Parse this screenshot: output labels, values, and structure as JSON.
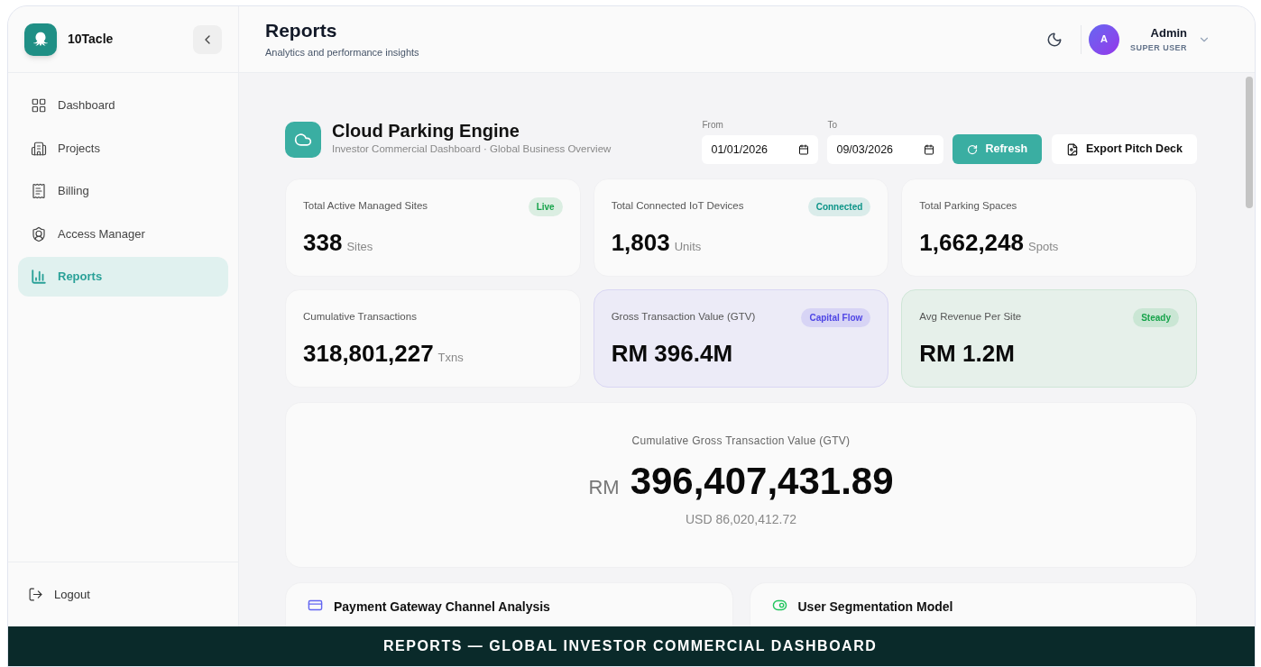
{
  "brand": {
    "name": "10Tacle"
  },
  "sidebar": {
    "items": [
      {
        "label": "Dashboard",
        "selected": false
      },
      {
        "label": "Projects",
        "selected": false
      },
      {
        "label": "Billing",
        "selected": false
      },
      {
        "label": "Access Manager",
        "selected": false
      },
      {
        "label": "Reports",
        "selected": true
      }
    ],
    "logout": "Logout"
  },
  "header": {
    "title": "Reports",
    "subtitle": "Analytics and performance insights",
    "user": {
      "initial": "A",
      "name": "Admin",
      "role": "SUPER USER"
    }
  },
  "engine": {
    "title": "Cloud Parking Engine",
    "subtitle": "Investor Commercial Dashboard · Global Business Overview",
    "from": {
      "label": "From",
      "value": "01/01/2026"
    },
    "to": {
      "label": "To",
      "value": "09/03/2026"
    },
    "refresh": "Refresh",
    "export": "Export Pitch Deck"
  },
  "stats": [
    {
      "kind": "plain",
      "label": "Total Active Managed Sites",
      "value": "338",
      "unit": "Sites",
      "badge": "Live",
      "color": "#16a34a"
    },
    {
      "kind": "plain",
      "label": "Total Connected IoT Devices",
      "value": "1,803",
      "unit": "Units",
      "badge": "Connected",
      "color": "#0d9488"
    },
    {
      "kind": "plain",
      "label": "Total Parking Spaces",
      "value": "1,662,248",
      "unit": "Spots"
    },
    {
      "kind": "plain",
      "label": "Cumulative Transactions",
      "value": "318,801,227",
      "unit": "Txns"
    },
    {
      "kind": "violet",
      "label": "Gross Transaction Value (GTV)",
      "value": "RM 396.4M",
      "badge": "Capital Flow",
      "color": "#4f46e5"
    },
    {
      "kind": "mint",
      "label": "Avg Revenue Per Site",
      "value": "RM 1.2M",
      "badge": "Steady",
      "color": "#16a34a"
    }
  ],
  "gtv": {
    "label": "Cumulative Gross Transaction Value (GTV)",
    "currency": "RM",
    "value": "396,407,431.89",
    "usd": "USD 86,020,412.72"
  },
  "panels": [
    {
      "title": "Payment Gateway Channel Analysis"
    },
    {
      "title": "User Segmentation Model"
    }
  ],
  "banner": "REPORTS — GLOBAL INVESTOR COMMERCIAL DASHBOARD"
}
